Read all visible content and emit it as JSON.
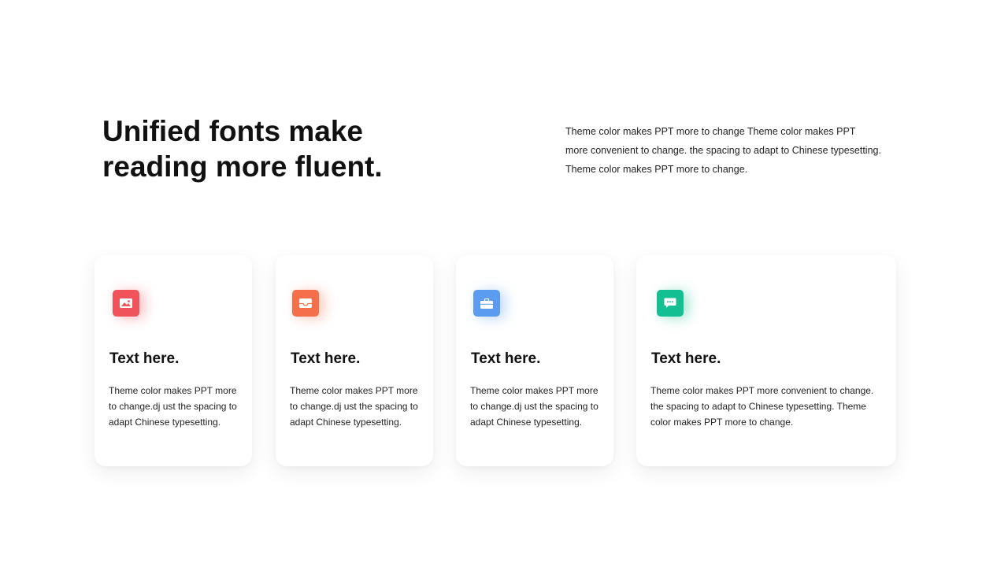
{
  "heading": {
    "line1": "Unified fonts make",
    "line2": "reading more fluent."
  },
  "intro": {
    "line1": "Theme  color makes PPT more to change Theme  color makes PPT",
    "line2": "more convenient to change. the spacing to adapt to Chinese typesetting.",
    "line3": "Theme  color makes PPT more to change."
  },
  "cards": [
    {
      "icon": "image-icon",
      "color": "#f0545a",
      "title": "Text here.",
      "lines": [
        "Theme  color makes PPT more",
        "to change.dj ust the spacing to",
        "adapt Chinese typesetting."
      ]
    },
    {
      "icon": "inbox-icon",
      "color": "#f5704a",
      "title": "Text here.",
      "lines": [
        "Theme  color makes PPT more",
        "to change.dj ust the spacing to",
        "adapt Chinese typesetting."
      ]
    },
    {
      "icon": "briefcase-icon",
      "color": "#5b9cf0",
      "title": "Text here.",
      "lines": [
        "Theme  color makes PPT more",
        "to change.dj ust the spacing to",
        "adapt Chinese typesetting."
      ]
    },
    {
      "icon": "chat-icon",
      "color": "#14c092",
      "title": "Text here.",
      "lines": [
        "Theme  color makes PPT more convenient to change.",
        "the spacing to adapt to Chinese typesetting. Theme",
        "color makes PPT more to change."
      ]
    }
  ]
}
